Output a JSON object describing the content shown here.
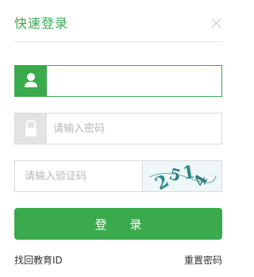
{
  "header": {
    "title": "快速登录"
  },
  "username": {
    "placeholder": ""
  },
  "password": {
    "placeholder": "请输入密码"
  },
  "captcha": {
    "placeholder": "请输入验证码",
    "image_text": "2514"
  },
  "login_button": {
    "label": "登 录"
  },
  "links": {
    "find_id": "找回教育ID",
    "reset_password": "重置密码"
  },
  "colors": {
    "accent": "#3aaa4c",
    "border": "#dcdcdc",
    "icon_inactive": "#e3e3e3"
  }
}
